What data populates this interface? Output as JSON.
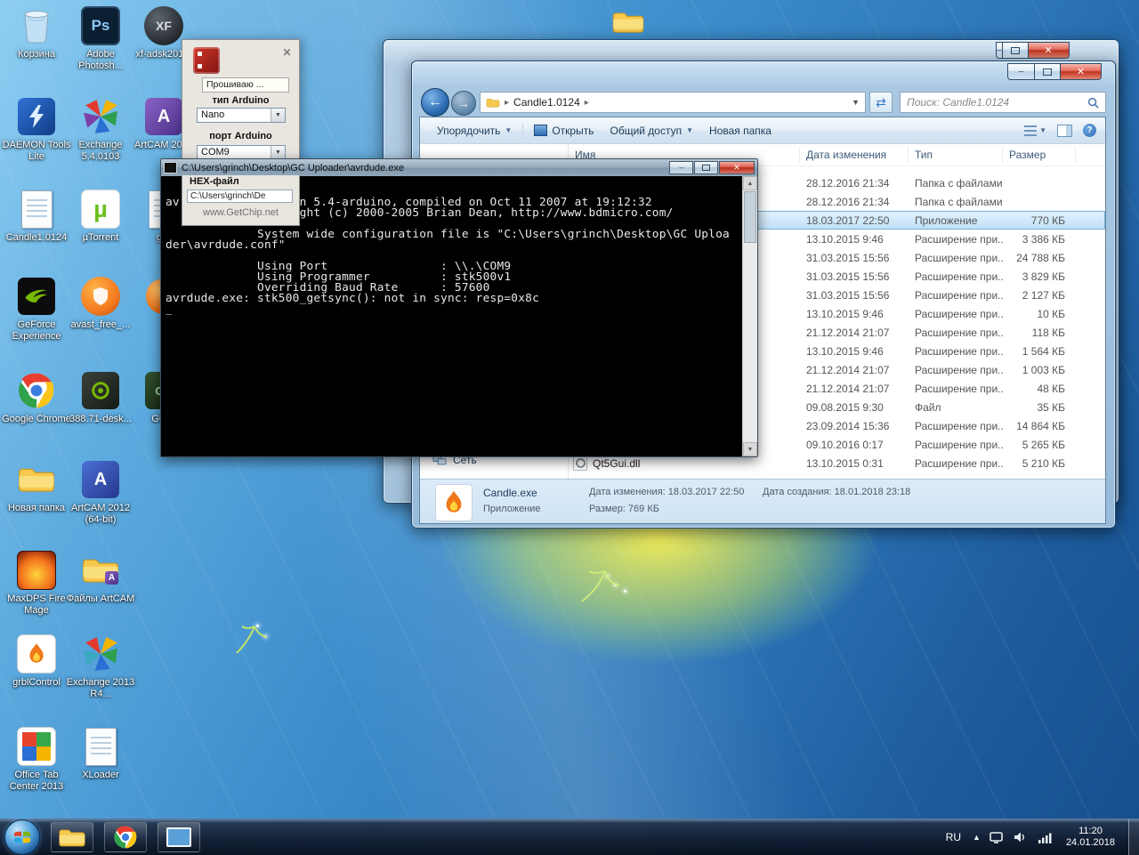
{
  "desktop": {
    "icons": [
      {
        "label": "Корзина"
      },
      {
        "label": "DAEMON Tools Lite"
      },
      {
        "label": "Candle1.0124"
      },
      {
        "label": "GeForce Experience"
      },
      {
        "label": "Google Chrome"
      },
      {
        "label": "Новая папка"
      },
      {
        "label": "MaxDPS Fire Mage"
      },
      {
        "label": "grblControl"
      },
      {
        "label": "Office Tab Center 2013"
      },
      {
        "label": "Adobe Photosh...",
        "glyph": "Ps"
      },
      {
        "label": "Exchange 5.4.0103"
      },
      {
        "label": "µTorrent",
        "glyph": "µ"
      },
      {
        "label": "avast_free_..."
      },
      {
        "label": "388.71-desk..."
      },
      {
        "label": "ArtCAM 2012 (64-bit)",
        "glyph": "A"
      },
      {
        "label": "Файлы ArtCAM",
        "glyph": "A"
      },
      {
        "label": "Exchange 2013 R4..."
      },
      {
        "label": "XLoader"
      },
      {
        "label": "xf-adsk201...",
        "glyph": "XF"
      },
      {
        "label": "ArtCAM 2009",
        "glyph": "A"
      },
      {
        "label": "grb"
      },
      {
        "label": ""
      },
      {
        "label": "GC U",
        "glyph": "GC"
      }
    ]
  },
  "gc": {
    "status": "Прошиваю ...",
    "type_label": "тип Arduino",
    "type_value": "Nano",
    "port_label": "порт Arduino",
    "port_value": "COM9",
    "hex_label": "HEX-файл",
    "hex_value": "C:\\Users\\grinch\\De",
    "site": "www.GetChip.net"
  },
  "console": {
    "title": "C:\\Users\\grinch\\Desktop\\GC Uploader\\avrdude.exe",
    "lines": [
      "avrdude.exe: Version 5.4-arduino, compiled on Oct 11 2007 at 19:12:32",
      "             Copyright (c) 2000-2005 Brian Dean, http://www.bdmicro.com/",
      "",
      "             System wide configuration file is \"C:\\Users\\grinch\\Desktop\\GC Uploa",
      "der\\avrdude.conf\"",
      "",
      "             Using Port                : \\\\.\\COM9",
      "             Using Programmer          : stk500v1",
      "             Overriding Baud Rate      : 57600",
      "avrdude.exe: stk500_getsync(): not in sync: resp=0x8c",
      "_"
    ]
  },
  "explorer": {
    "address": "Candle1.0124",
    "search": "Поиск: Candle1.0124",
    "toolbar": {
      "organize": "Упорядочить",
      "open": "Открыть",
      "share": "Общий доступ",
      "new_folder": "Новая папка"
    },
    "columns": [
      "Имя",
      "Дата изменения",
      "Тип",
      "Размер"
    ],
    "sidebar_network": "Сеть",
    "rows": [
      {
        "name": "",
        "date": "28.12.2016 21:34",
        "type": "Папка с файлами",
        "size": ""
      },
      {
        "name": "",
        "date": "28.12.2016 21:34",
        "type": "Папка с файлами",
        "size": ""
      },
      {
        "name": "",
        "date": "18.03.2017 22:50",
        "type": "Приложение",
        "size": "770 КБ"
      },
      {
        "name": "",
        "date": "13.10.2015 9:46",
        "type": "Расширение при...",
        "size": "3 386 КБ"
      },
      {
        "name": "",
        "date": "31.03.2015 15:56",
        "type": "Расширение при...",
        "size": "24 788 КБ"
      },
      {
        "name": "",
        "date": "31.03.2015 15:56",
        "type": "Расширение при...",
        "size": "3 829 КБ"
      },
      {
        "name": "",
        "date": "31.03.2015 15:56",
        "type": "Расширение при...",
        "size": "2 127 КБ"
      },
      {
        "name": "",
        "date": "13.10.2015 9:46",
        "type": "Расширение при...",
        "size": "10 КБ"
      },
      {
        "name": "",
        "date": "21.12.2014 21:07",
        "type": "Расширение при...",
        "size": "118 КБ"
      },
      {
        "name": "",
        "date": "13.10.2015 9:46",
        "type": "Расширение при...",
        "size": "1 564 КБ"
      },
      {
        "name": "",
        "date": "21.12.2014 21:07",
        "type": "Расширение при...",
        "size": "1 003 КБ"
      },
      {
        "name": "",
        "date": "21.12.2014 21:07",
        "type": "Расширение при...",
        "size": "48 КБ"
      },
      {
        "name": "",
        "date": "09.08.2015 9:30",
        "type": "Файл",
        "size": "35 КБ"
      },
      {
        "name": "",
        "date": "23.09.2014 15:36",
        "type": "Расширение при...",
        "size": "14 864 КБ"
      },
      {
        "name": "",
        "date": "09.10.2016 0:17",
        "type": "Расширение при...",
        "size": "5 265 КБ"
      },
      {
        "name": "Qt5Gui.dll",
        "date": "13.10.2015 0:31",
        "type": "Расширение при...",
        "size": "5 210 КБ"
      }
    ],
    "details": {
      "file": "Candle.exe",
      "type": "Приложение",
      "modified": "Дата изменения: 18.03.2017 22:50",
      "size": "Размер: 769 КБ",
      "created": "Дата создания: 18.01.2018 23:18"
    }
  },
  "taskbar": {
    "lang": "RU",
    "time": "11:20",
    "date": "24.01.2018"
  }
}
